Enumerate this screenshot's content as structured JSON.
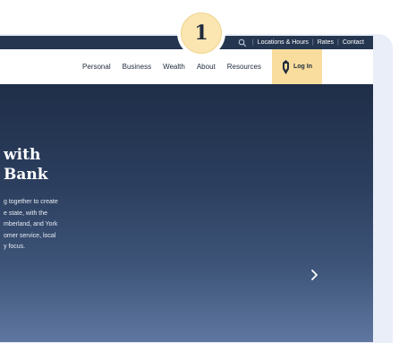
{
  "step_badge": {
    "number": "1"
  },
  "utility_bar": {
    "search_icon": "search-icon",
    "links": [
      "Locations & Hours",
      "Rates",
      "Contact"
    ]
  },
  "nav": {
    "items": [
      "Personal",
      "Business",
      "Wealth",
      "About",
      "Resources"
    ],
    "login_icon": "bank-logo-icon",
    "login_label": "Log In"
  },
  "hero": {
    "title_line1": "with",
    "title_line2": "Bank",
    "body_lines": [
      "g together to create",
      "e state, with the",
      "mberland, and York",
      "omer service, local",
      "y focus."
    ],
    "next_icon": "chevron-right-icon"
  },
  "colors": {
    "utility_bar": "#253650",
    "login_button": "#f8dd9e",
    "badge": "#fbe6b1",
    "hero_top": "#1f2e48",
    "hero_bottom": "#5f77a0"
  }
}
